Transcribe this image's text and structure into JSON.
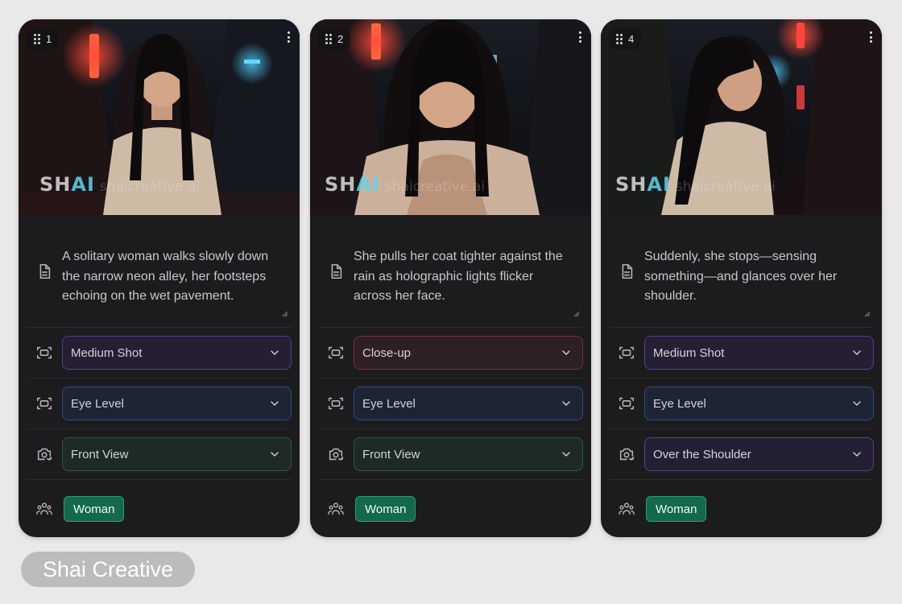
{
  "cards": [
    {
      "index": "1",
      "prompt": "A solitary woman walks slowly down the narrow neon alley, her footsteps echoing on the wet pavement.",
      "shot": "Medium Shot",
      "angle": "Eye Level",
      "view": "Front View",
      "tag": "Woman",
      "watermark_logo": "SHAI",
      "watermark_url": "shaicreative.ai"
    },
    {
      "index": "2",
      "prompt": "She pulls her coat tighter against the rain as holographic lights flicker across her face.",
      "shot": "Close-up",
      "angle": "Eye Level",
      "view": "Front View",
      "tag": "Woman",
      "watermark_logo": "SHAI",
      "watermark_url": "shaicreative.ai"
    },
    {
      "index": "4",
      "prompt": "Suddenly, she stops—sensing something—and glances over her shoulder.",
      "shot": "Medium Shot",
      "angle": "Eye Level",
      "view": "Over the Shoulder",
      "tag": "Woman",
      "watermark_logo": "SHAI",
      "watermark_url": "shaicreative.ai"
    }
  ],
  "brand": "Shai Creative",
  "colors": {
    "page_bg": "#e9e9ea",
    "card_bg": "#1c1c1f",
    "chip_green": "#14684c",
    "accent_purple": "#5c3d93",
    "accent_blue": "#34497e",
    "accent_green": "#2d5a40",
    "accent_red": "#7c2e3c"
  },
  "icons": [
    "drag-handle-icon",
    "more-vertical-icon",
    "document-icon",
    "frame-focus-icon",
    "camera-rotate-icon",
    "people-icon",
    "chevron-down-icon",
    "resize-handle-icon"
  ]
}
